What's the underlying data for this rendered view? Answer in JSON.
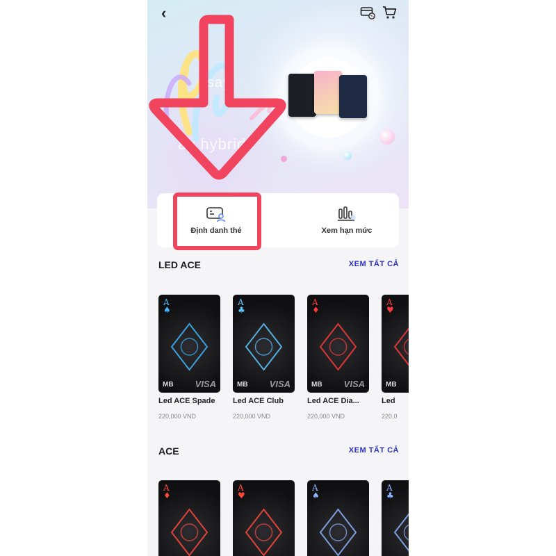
{
  "banner": {
    "text_line1": "say",
    "text_line2": "ay hybrid"
  },
  "actions": [
    {
      "label": "Định danh thẻ",
      "icon": "card-user-icon"
    },
    {
      "label": "Xem hạn mức",
      "icon": "limit-chart-icon"
    }
  ],
  "sections": [
    {
      "title": "LED ACE",
      "view_all": "XEM TẤT CẢ",
      "products": [
        {
          "name": "Led ACE Spade",
          "price": "220,000 VND",
          "suit": "♠",
          "accent": "#3fb8ff"
        },
        {
          "name": "Led ACE Club",
          "price": "220,000 VND",
          "suit": "♣",
          "accent": "#5ec8ff"
        },
        {
          "name": "Led ACE Dia...",
          "price": "220,000 VND",
          "suit": "♦",
          "accent": "#ff3b3b"
        },
        {
          "name": "Led",
          "price": "220,0",
          "suit": "♥",
          "accent": "#ff3b3b"
        }
      ]
    },
    {
      "title": "ACE",
      "view_all": "XEM TẤT CẢ",
      "products": [
        {
          "suit": "♦",
          "accent": "#ff4a3d"
        },
        {
          "suit": "♥",
          "accent": "#ff4a3d"
        },
        {
          "suit": "♠",
          "accent": "#8fb4ff"
        },
        {
          "suit": "♣",
          "accent": "#8fb4ff"
        }
      ]
    }
  ],
  "card_brand": {
    "issuer": "MB",
    "network": "VISA"
  },
  "colors": {
    "highlight": "#f0445f",
    "link": "#2b2fc7"
  }
}
